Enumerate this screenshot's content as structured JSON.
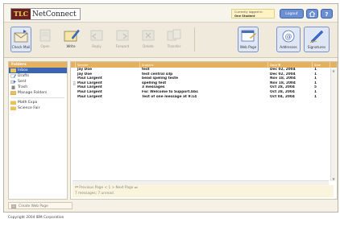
{
  "header": {
    "logo_mark": "TLC",
    "logo_text": "NetConnect",
    "login_label": "Currently logged in:",
    "login_user": "One Student",
    "logout_label": "Logout",
    "home_icon": "home-icon",
    "help_icon": "help-icon"
  },
  "toolbar": {
    "items": [
      {
        "label": "Check Mail",
        "icon": "check-mail-icon",
        "state": "active"
      },
      {
        "label": "Open",
        "icon": "open-icon",
        "state": "disabled"
      },
      {
        "label": "Write",
        "icon": "write-icon",
        "state": "enabled"
      },
      {
        "label": "Reply",
        "icon": "reply-icon",
        "state": "disabled"
      },
      {
        "label": "Forward",
        "icon": "forward-icon",
        "state": "disabled"
      },
      {
        "label": "Delete",
        "icon": "delete-icon",
        "state": "disabled"
      },
      {
        "label": "Transfer",
        "icon": "transfer-icon",
        "state": "disabled"
      },
      {
        "label": "Web Page",
        "icon": "web-page-icon",
        "state": "active"
      },
      {
        "label": "Addresses",
        "icon": "addresses-icon",
        "state": "active"
      },
      {
        "label": "Signatures",
        "icon": "signatures-icon",
        "state": "active"
      }
    ]
  },
  "folders": {
    "title": "Folders",
    "items": [
      {
        "label": "Inbox",
        "icon": "inbox-icon",
        "selected": true
      },
      {
        "label": "Drafts",
        "icon": "drafts-icon",
        "selected": false
      },
      {
        "label": "Sent",
        "icon": "sent-icon",
        "selected": false
      },
      {
        "label": "Trash",
        "icon": "trash-icon",
        "selected": false
      },
      {
        "label": "Manage Folders",
        "icon": "manage-folders-icon",
        "selected": false
      },
      {
        "label": "Math Expo",
        "icon": "folder-icon",
        "selected": false
      },
      {
        "label": "Science Fair",
        "icon": "folder-icon",
        "selected": false
      }
    ]
  },
  "messages": {
    "columns": {
      "sender": "Sender",
      "subject": "Subject",
      "date": "Date ▼",
      "size": "Size"
    },
    "rows": [
      {
        "sender": "Jay Doe",
        "subject": "test",
        "date": "Dec 02, 2004",
        "size": "1"
      },
      {
        "sender": "Jay Doe",
        "subject": "test central silp",
        "date": "Dec 02, 2004",
        "size": "1"
      },
      {
        "sender": "Paul Largent",
        "subject": "bead speling teste",
        "date": "Nov 18, 2004",
        "size": "1"
      },
      {
        "sender": "Paul Largent",
        "subject": "spelling test",
        "date": "Nov 18, 2004",
        "size": "1"
      },
      {
        "sender": "Paul Largent",
        "subject": "3 messages",
        "date": "Oct 28, 2004",
        "size": "5"
      },
      {
        "sender": "Paul Largent",
        "subject": "Fw: Welcome to Support.bbs",
        "date": "Oct 28, 2004",
        "size": "1"
      },
      {
        "sender": "Paul Largent",
        "subject": "Test of one message at 9:14",
        "date": "Oct 04, 2004",
        "size": "1"
      }
    ],
    "pager_nav": "⏮ Previous Page < 1 > Next Page ⏭",
    "pager_status": "7 messages; 7 unread."
  },
  "footer": {
    "create_label": "Create Web Page",
    "copyright": "Copyright 2004 IBM Corporation"
  },
  "colors": {
    "panel_header": "#e4b25f",
    "selected": "#3c64b4",
    "button_blue": "#6c8fd3",
    "logo_red": "#6b1f1f"
  }
}
